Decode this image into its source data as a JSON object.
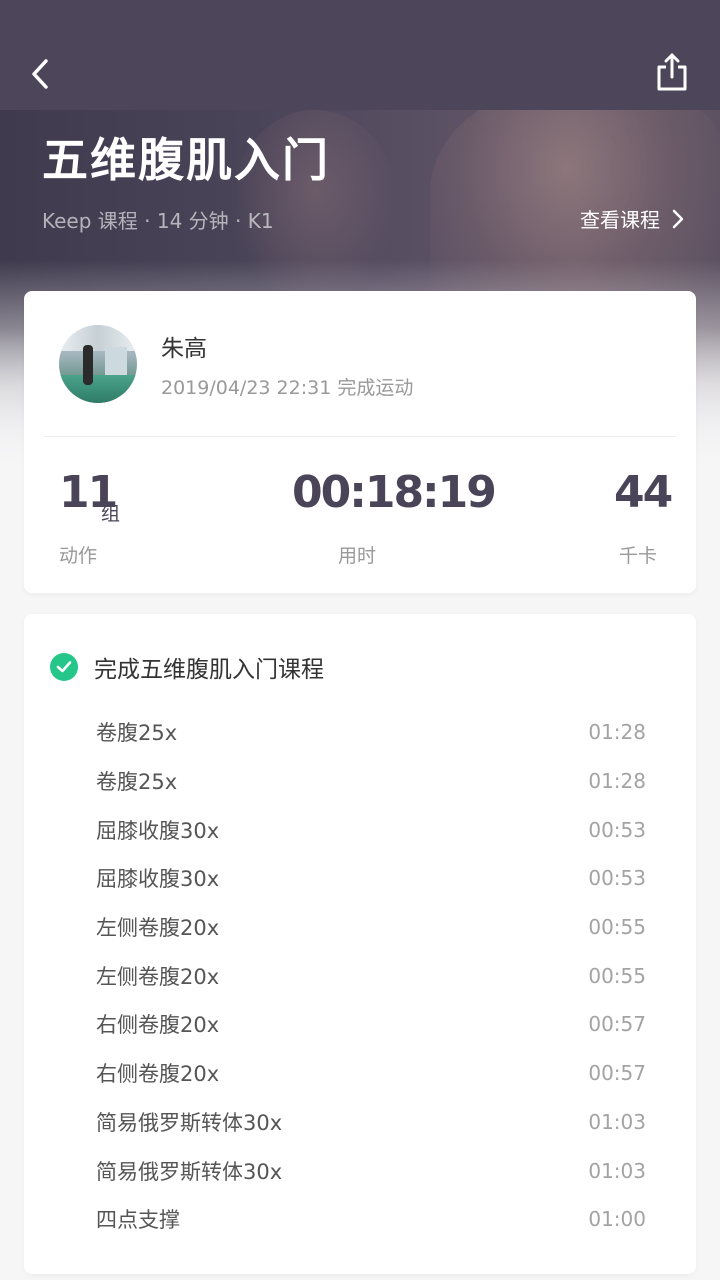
{
  "header": {
    "back_icon": "chevron-left-icon",
    "share_icon": "share-icon"
  },
  "course": {
    "title": "五维腹肌入门",
    "meta": "Keep 课程 · 14 分钟 · K1",
    "view_course_label": "查看课程"
  },
  "summary": {
    "user_name": "朱高",
    "finish_time": "2019/04/23 22:31 完成运动",
    "stats": {
      "sets": {
        "value": "11",
        "unit": "组",
        "label": "动作"
      },
      "duration": {
        "value": "00:18:19",
        "label": "用时"
      },
      "calories": {
        "value": "44",
        "label": "千卡"
      }
    }
  },
  "completion": {
    "title": "完成五维腹肌入门课程",
    "status_color": "#24c789"
  },
  "exercises": [
    {
      "name": "卷腹25x",
      "duration": "01:28"
    },
    {
      "name": "卷腹25x",
      "duration": "01:28"
    },
    {
      "name": "屈膝收腹30x",
      "duration": "00:53"
    },
    {
      "name": "屈膝收腹30x",
      "duration": "00:53"
    },
    {
      "name": "左侧卷腹20x",
      "duration": "00:55"
    },
    {
      "name": "左侧卷腹20x",
      "duration": "00:55"
    },
    {
      "name": "右侧卷腹20x",
      "duration": "00:57"
    },
    {
      "name": "右侧卷腹20x",
      "duration": "00:57"
    },
    {
      "name": "简易俄罗斯转体30x",
      "duration": "01:03"
    },
    {
      "name": "简易俄罗斯转体30x",
      "duration": "01:03"
    },
    {
      "name": "四点支撑",
      "duration": "01:00"
    }
  ]
}
